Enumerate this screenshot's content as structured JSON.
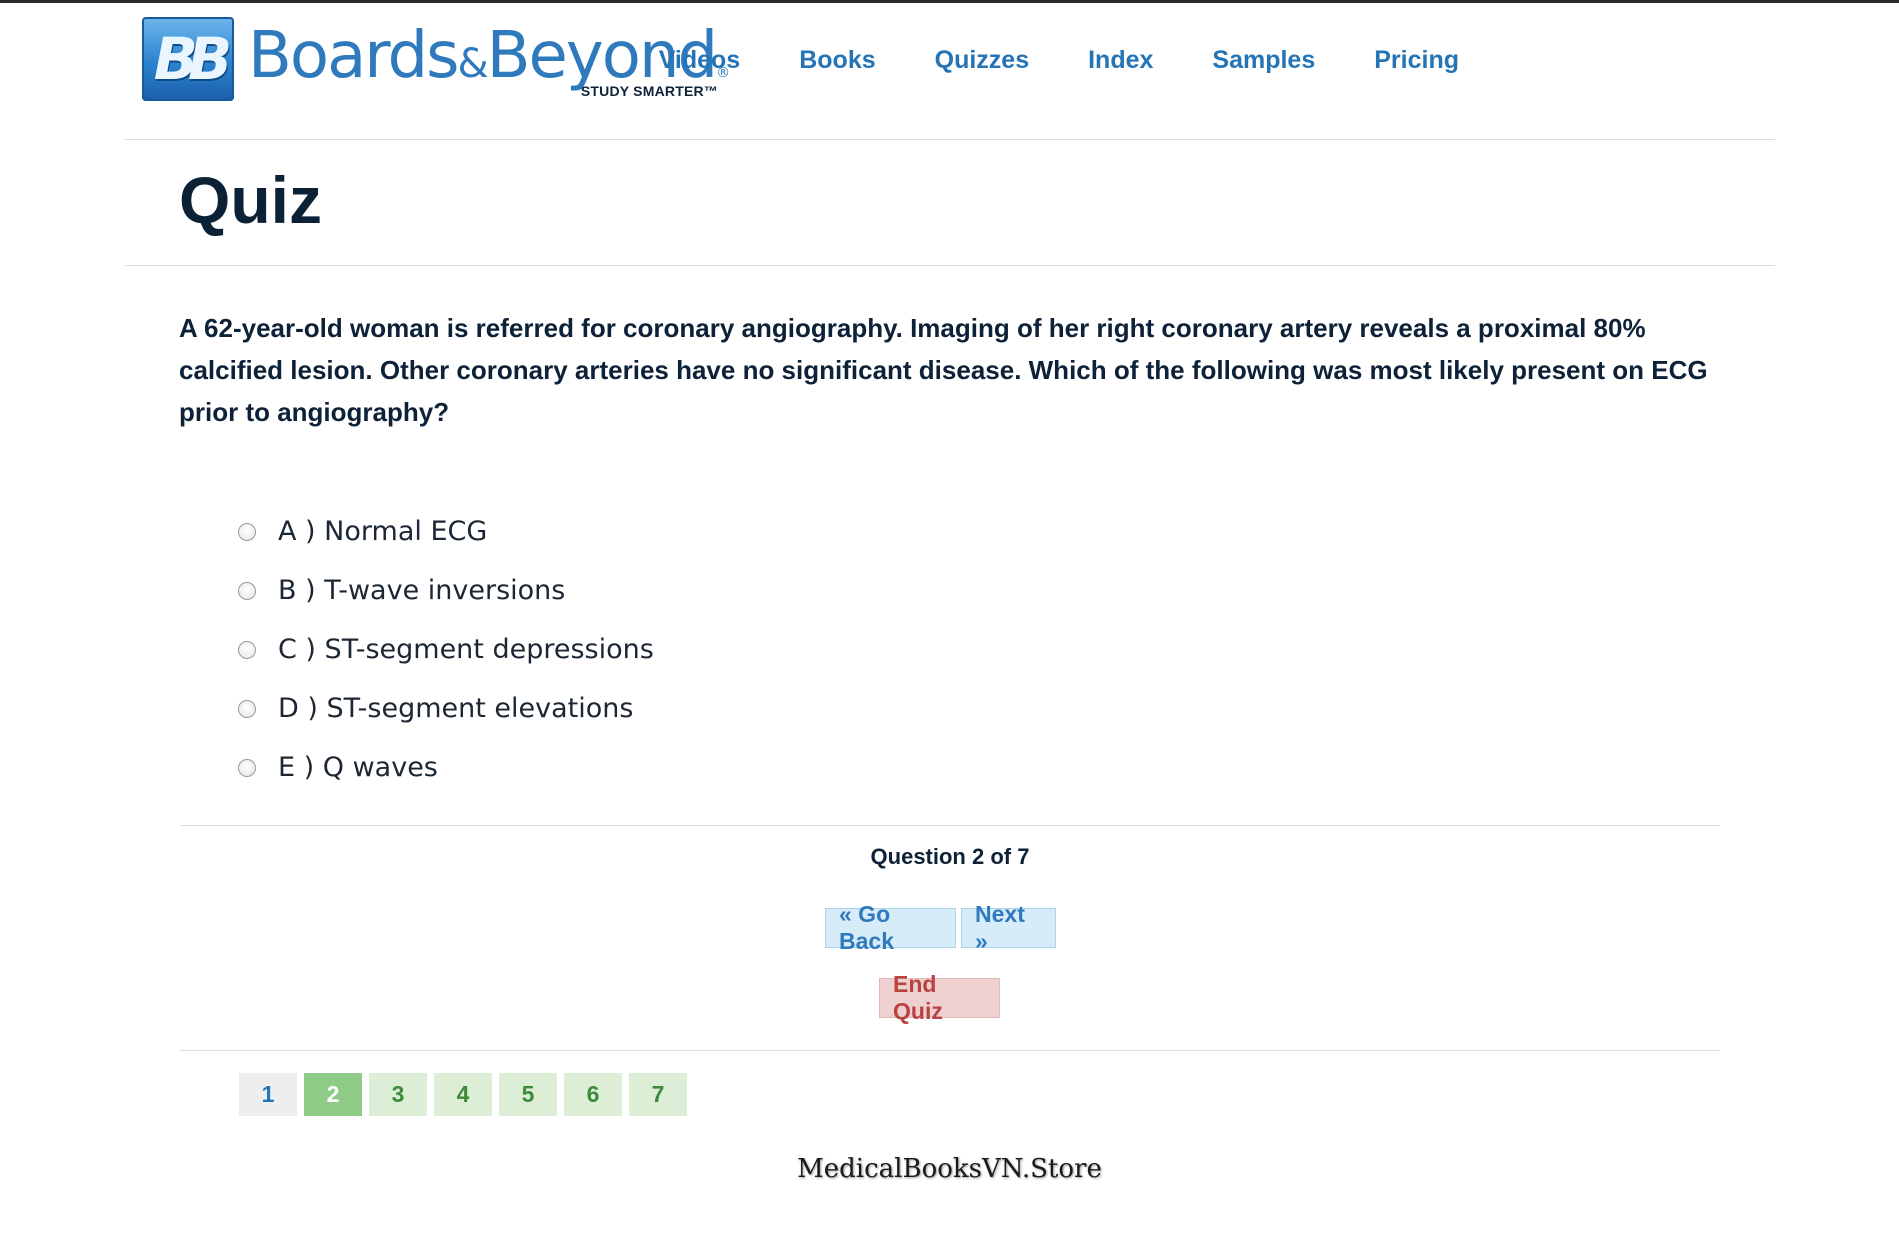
{
  "header": {
    "logo": {
      "mark": "BB",
      "brand_left": "Boards",
      "brand_amp": "&",
      "brand_right": "Beyond",
      "registered": "®",
      "tagline": "STUDY SMARTER™"
    },
    "nav": [
      "Videos",
      "Books",
      "Quizzes",
      "Index",
      "Samples",
      "Pricing"
    ]
  },
  "page": {
    "title": "Quiz"
  },
  "quiz": {
    "question": "A 62-year-old woman is referred for coronary angiography. Imaging of her right coronary artery reveals a proximal 80% calcified lesion. Other coronary arteries have no significant disease. Which of the following was most likely present on ECG prior to angiography?",
    "options": [
      "A ) Normal ECG",
      "B ) T-wave inversions",
      "C ) ST-segment depressions",
      "D ) ST-segment elevations",
      "E ) Q waves"
    ],
    "counter": "Question 2 of 7",
    "back_label": "« Go Back",
    "next_label": "Next »",
    "end_label": "End Quiz",
    "pages": [
      "1",
      "2",
      "3",
      "4",
      "5",
      "6",
      "7"
    ],
    "current_page": "2"
  },
  "watermark": "MedicalBooksVN.Store",
  "colors": {
    "brand_blue": "#2474b6",
    "title_navy": "#0b2236",
    "success_green": "#8dcb87",
    "danger_red": "#b8433e"
  }
}
